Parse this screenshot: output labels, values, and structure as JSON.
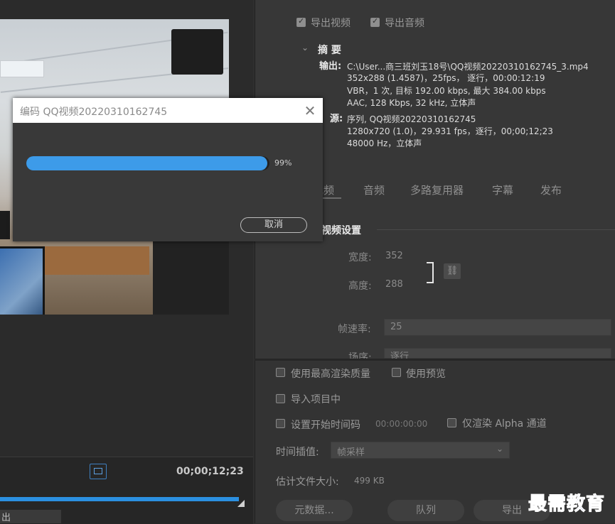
{
  "export_settings": {
    "export_video_label": "导出视频",
    "export_audio_label": "导出音频",
    "summary_heading": "摘 要",
    "output_label": "输出:",
    "output_lines": [
      "C:\\User...商三班刘玉18号\\QQ视频20220310162745_3.mp4",
      "352x288 (1.4587)，25fps， 逐行，00:00:12:19",
      "VBR，1 次, 目标 192.00 kbps, 最大 384.00 kbps",
      "AAC, 128 Kbps, 32  kHz, 立体声"
    ],
    "source_label": "源:",
    "source_lines": [
      "序列, QQ视频20220310162745",
      "1280x720 (1.0)，29.931 fps，逐行，00;00;12;23",
      "48000 Hz，立体声"
    ]
  },
  "tabs": [
    "视频",
    "音频",
    "多路复用器",
    "字幕",
    "发布"
  ],
  "video_settings": {
    "heading": "视频设置",
    "width_label": "宽度:",
    "width_value": "352",
    "height_label": "高度:",
    "height_value": "288",
    "framerate_label": "帧速率:",
    "framerate_value": "25",
    "field_order_label": "场序:",
    "field_order_value": "逐行"
  },
  "options": {
    "max_render_quality": "使用最高渲染质量",
    "use_previews": "使用预览",
    "import_into_project": "导入项目中",
    "set_start_timecode": "设置开始时间码",
    "start_timecode_value": "00:00:00:00",
    "render_alpha_only": "仅渲染 Alpha 通道",
    "time_interpolation_label": "时间插值:",
    "time_interpolation_value": "帧采样",
    "estimated_size_label": "估计文件大小:",
    "estimated_size_value": "499 KB"
  },
  "buttons": {
    "metadata": "元数据...",
    "queue": "队列",
    "export": "导出"
  },
  "left_panel": {
    "timecode": "00;00;12;23",
    "export_partial": "出"
  },
  "dialog": {
    "title": "编码 QQ视频20220310162745",
    "progress": 0.99,
    "progress_label": "99%",
    "cancel_label": "取消",
    "close_glyph": "✕"
  },
  "watermark": "最需教育",
  "colors": {
    "progress_blue": "#3d9be9",
    "timeline_blue": "#2b8fe0",
    "watermark_blue": "#1d2f9c"
  }
}
